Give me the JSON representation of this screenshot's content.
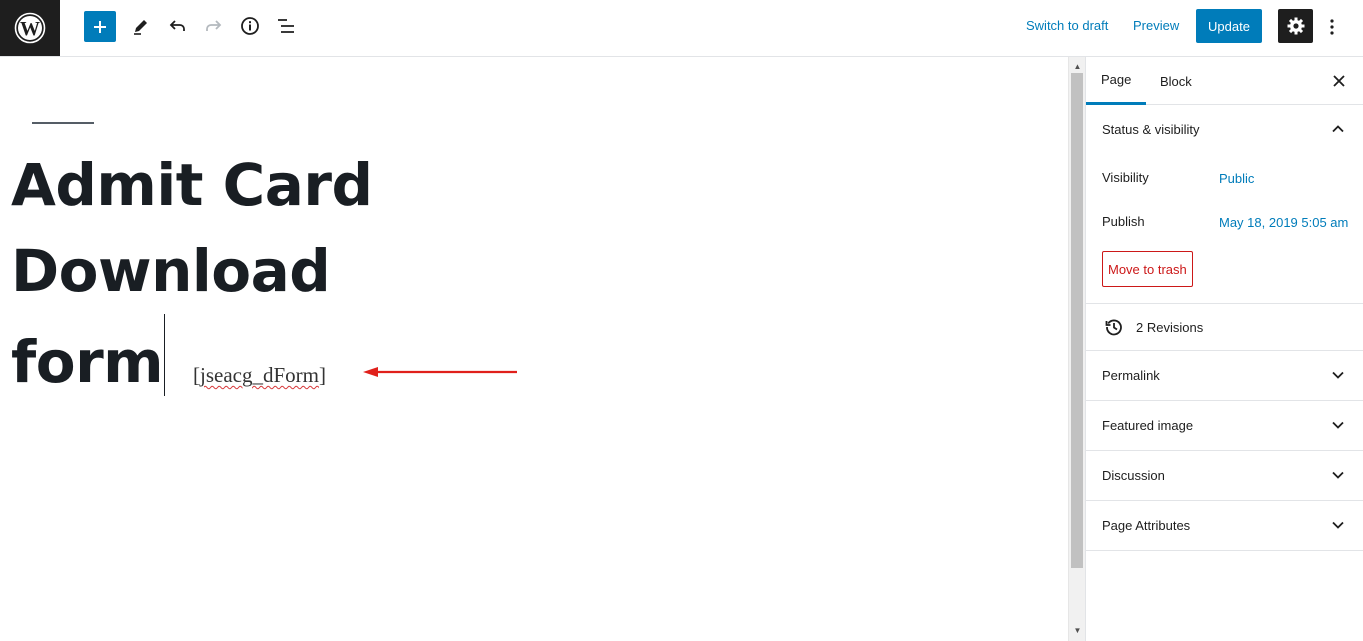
{
  "toolbar": {
    "logo_icon": "wordpress-logo-icon",
    "add_icon": "plus-icon",
    "tools_icon": "pencil-icon",
    "undo_icon": "undo-icon",
    "redo_icon": "redo-icon",
    "info_icon": "info-icon",
    "outline_icon": "list-view-icon",
    "switch_to_draft": "Switch to draft",
    "preview": "Preview",
    "update": "Update",
    "settings_icon": "gear-icon",
    "more_icon": "more-vertical-icon",
    "accent_color": "#007cba"
  },
  "editor": {
    "title_line1": "Admit Card Download",
    "title_line2": "form",
    "shortcode_open": "[",
    "shortcode_word": "jseacg_dForm",
    "shortcode_close": "]",
    "arrow_color": "#e0201b"
  },
  "sidebar": {
    "tabs": [
      {
        "label": "Page",
        "active": true
      },
      {
        "label": "Block",
        "active": false
      }
    ],
    "close_icon": "close-icon",
    "status_panel": {
      "title": "Status & visibility",
      "expanded": true,
      "visibility_label": "Visibility",
      "visibility_value": "Public",
      "publish_label": "Publish",
      "publish_value": "May 18, 2019 5:05 am",
      "trash_label": "Move to trash"
    },
    "revisions": {
      "label": "2 Revisions",
      "icon": "history-icon"
    },
    "panels": [
      {
        "title": "Permalink"
      },
      {
        "title": "Featured image"
      },
      {
        "title": "Discussion"
      },
      {
        "title": "Page Attributes"
      }
    ]
  }
}
